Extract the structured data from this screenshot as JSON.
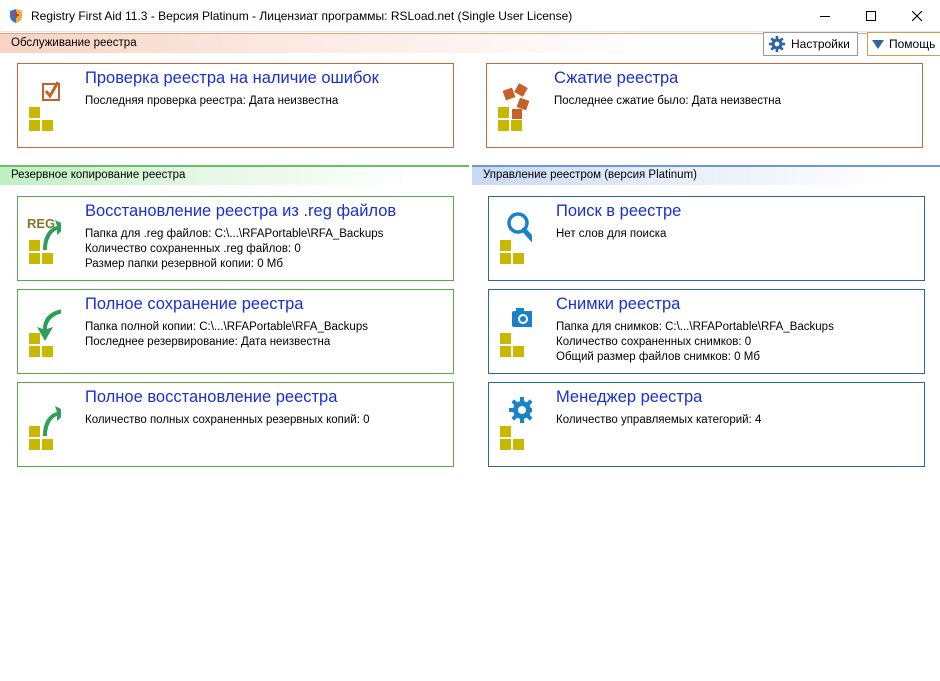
{
  "window": {
    "title": "Registry First Aid 11.3 - Версия Platinum - Лицензиат программы: RSLoad.net (Single User License)"
  },
  "toolbar": {
    "settings_label": "Настройки",
    "help_label": "Помощь"
  },
  "sections": {
    "maintenance": "Обслуживание реестра",
    "backup": "Резервное копирование реестра",
    "management": "Управление реестром (версия Platinum)"
  },
  "cards": {
    "check": {
      "title": "Проверка реестра на наличие ошибок",
      "lines": [
        "Последняя проверка реестра: Дата неизвестна"
      ]
    },
    "compress": {
      "title": "Сжатие реестра",
      "lines": [
        "Последнее сжатие было: Дата неизвестна"
      ]
    },
    "restore_reg": {
      "title": "Восстановление реестра из .reg файлов",
      "lines": [
        "Папка для .reg файлов: C:\\...\\RFAPortable\\RFA_Backups",
        "Количество сохраненных .reg файлов: 0",
        "Размер папки резервной копии: 0 Мб"
      ]
    },
    "full_save": {
      "title": "Полное сохранение реестра",
      "lines": [
        "Папка полной копии: C:\\...\\RFAPortable\\RFA_Backups",
        "Последнее резервирование: Дата неизвестна"
      ]
    },
    "full_restore": {
      "title": "Полное восстановление реестра",
      "lines": [
        "Количество полных сохраненных резервных копий: 0"
      ]
    },
    "search": {
      "title": "Поиск в реестре",
      "lines": [
        "Нет слов для поиска"
      ]
    },
    "snapshots": {
      "title": "Снимки реестра",
      "lines": [
        "Папка для снимков: C:\\...\\RFAPortable\\RFA_Backups",
        "Количество сохраненных снимков: 0",
        "Общий размер файлов снимков: 0 Мб"
      ]
    },
    "manager": {
      "title": "Менеджер реестра",
      "lines": [
        "Количество управляемых категорий: 4"
      ]
    }
  },
  "icons": {
    "reg_text": "REG"
  },
  "colors": {
    "card_title": "#1a2fd0",
    "maintenance_border": "#c5693a",
    "backup_border": "#5ba84a",
    "management_border": "#2e64a5",
    "tile_yellow": "#c9b800",
    "arrow_green": "#2e9e5c",
    "icon_blue": "#1a82c7",
    "brick_orange": "#c8602a"
  }
}
